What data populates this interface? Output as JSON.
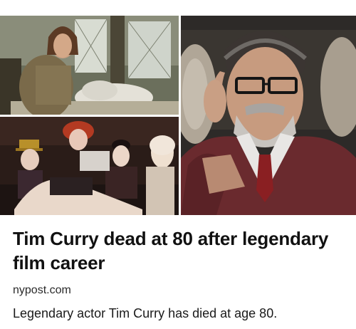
{
  "article": {
    "headline": "Tim Curry dead at 80 after legendary film career",
    "source": "nypost.com",
    "summary": "Legendary actor Tim Curry has died at age 80."
  },
  "images": [
    {
      "name": "photo-film-still-period"
    },
    {
      "name": "photo-film-still-cast"
    },
    {
      "name": "photo-portrait"
    }
  ]
}
